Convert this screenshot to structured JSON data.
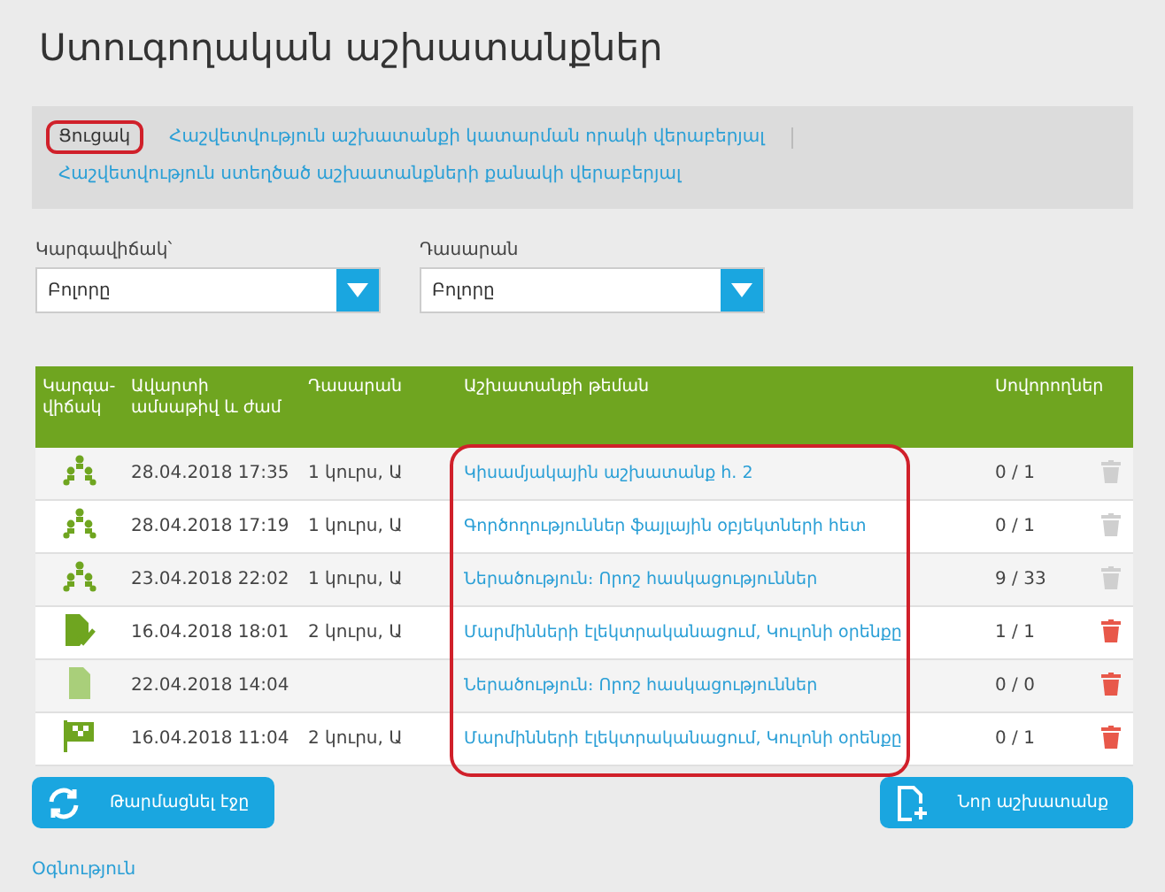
{
  "title": "Ստուգողական աշխատանքներ",
  "nav": {
    "highlighted": true,
    "links": [
      {
        "label": "Ցուցակ",
        "selected": true
      },
      {
        "label": "Հաշվետվություն աշխատանքի կատարման որակի վերաբերյալ",
        "selected": false
      },
      {
        "label": "Հաշվետվություն ստեղծած աշխատանքների քանակի վերաբերյալ",
        "selected": false
      }
    ]
  },
  "filters": [
    {
      "label": "Կարգավիճակ՝",
      "value": "Բոլորը"
    },
    {
      "label": "Դասարան",
      "value": "Բոլորը"
    }
  ],
  "table": {
    "columns": [
      "Կարգա-վիճակ",
      "Ավարտի ամսաթիվ և ժամ",
      "Դասարան",
      "Աշխատանքի թեման",
      "Սովորողներ"
    ],
    "topics_highlighted": true,
    "rows": [
      {
        "kind": "group",
        "date": "28.04.2018 17:35",
        "class": "1 կուրս, Ա",
        "topic": "Կիսամյակային աշխատանք h. 2",
        "students": "0 / 1",
        "deletable": false
      },
      {
        "kind": "group",
        "date": "28.04.2018 17:19",
        "class": "1 կուրս, Ա",
        "topic": "Գործողություններ ֆայլային օբյեկտների հետ",
        "students": "0 / 1",
        "deletable": false
      },
      {
        "kind": "group",
        "date": "23.04.2018 22:02",
        "class": "1 կուրս, Ա",
        "topic": "Ներածություն։ Որոշ հասկացություններ",
        "students": "9 / 33",
        "deletable": false
      },
      {
        "kind": "checked",
        "date": "16.04.2018 18:01",
        "class": "2 կուրս, Ա",
        "topic": "Մարմինների էլեկտրականացում, Կուլոնի օրենքը",
        "students": "1 / 1",
        "deletable": true
      },
      {
        "kind": "draft",
        "date": "22.04.2018 14:04",
        "topic": "Ներածություն։ Որոշ հասկացություններ",
        "students": "0 / 0",
        "deletable": true
      },
      {
        "kind": "finished",
        "date": "16.04.2018 11:04",
        "class": "2 կուրս, Ա",
        "topic": "Մարմինների էլեկտրականացում, Կուլոնի օրենքը",
        "students": "0 / 1",
        "deletable": true
      }
    ]
  },
  "buttons": [
    {
      "kind": "refresh",
      "label": "Թարմացնել էջը"
    },
    {
      "kind": "new",
      "label": "Նոր աշխատանք"
    }
  ],
  "help_link": "Օգնություն"
}
